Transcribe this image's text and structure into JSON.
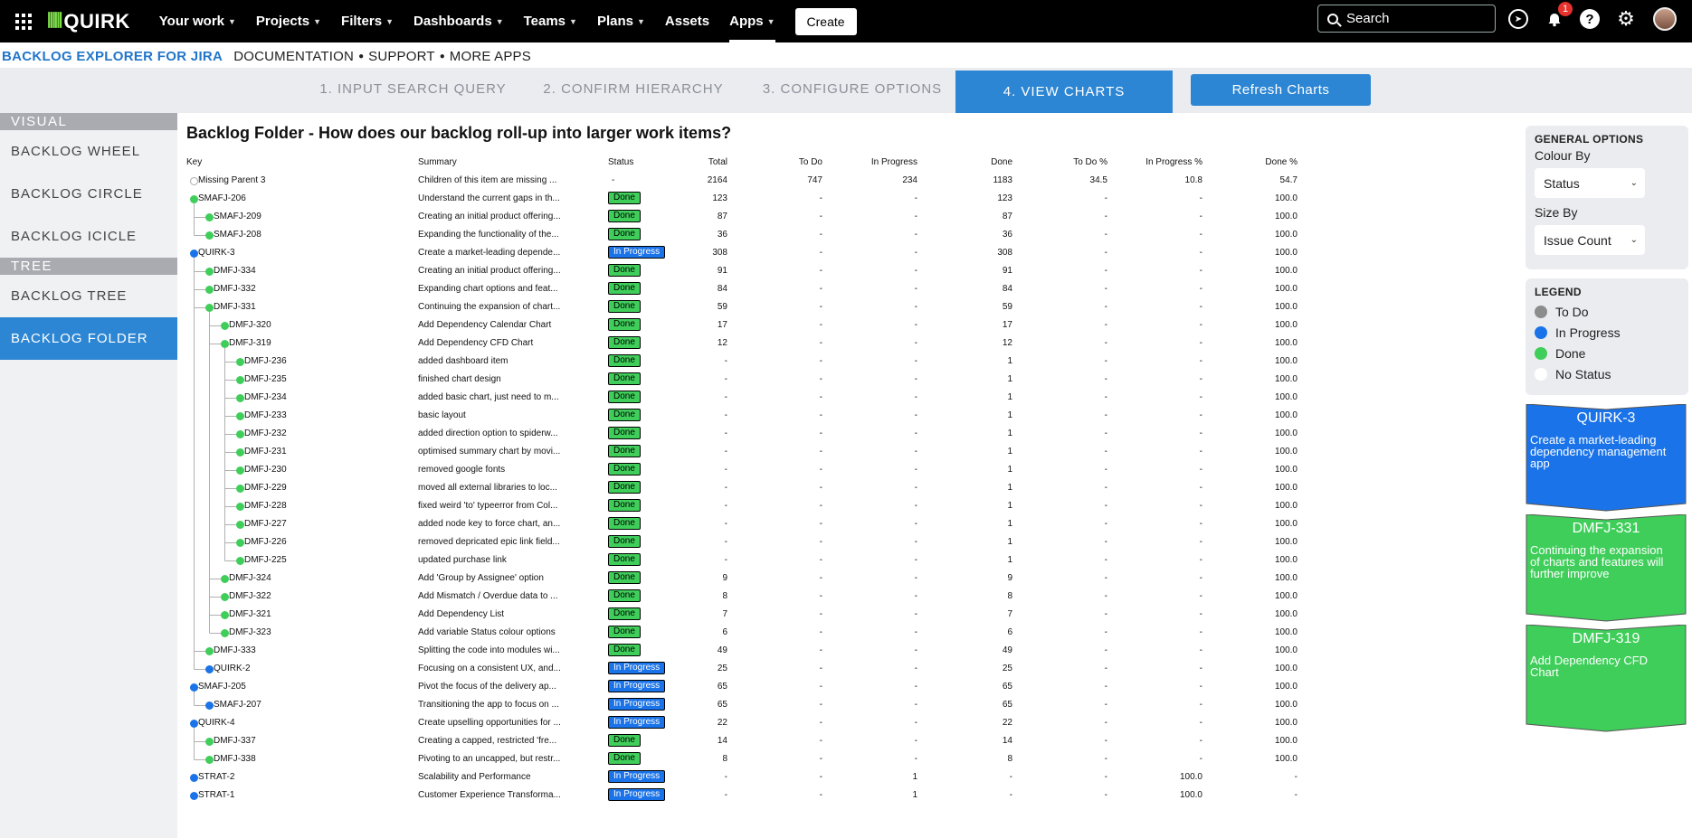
{
  "topnav": {
    "logo_mark": "⦀⦀",
    "logo_text": "QUIRK",
    "items": [
      {
        "label": "Your work",
        "chevron": true
      },
      {
        "label": "Projects",
        "chevron": true
      },
      {
        "label": "Filters",
        "chevron": true
      },
      {
        "label": "Dashboards",
        "chevron": true
      },
      {
        "label": "Teams",
        "chevron": true
      },
      {
        "label": "Plans",
        "chevron": true
      },
      {
        "label": "Assets",
        "chevron": false
      },
      {
        "label": "Apps",
        "chevron": true,
        "active": true
      }
    ],
    "create_label": "Create",
    "search_placeholder": "Search",
    "notification_count": "1"
  },
  "apphead": {
    "app_name": "BACKLOG EXPLORER FOR JIRA",
    "links": [
      "DOCUMENTATION",
      "SUPPORT",
      "MORE APPS"
    ]
  },
  "steps": [
    {
      "label": "1. INPUT SEARCH QUERY"
    },
    {
      "label": "2. CONFIRM HIERARCHY"
    },
    {
      "label": "3. CONFIGURE OPTIONS"
    },
    {
      "label": "4. VIEW CHARTS",
      "active": true
    }
  ],
  "refresh_label": "Refresh Charts",
  "sidebar": {
    "visual_header": "VISUAL",
    "visual_items": [
      "BACKLOG WHEEL",
      "BACKLOG CIRCLE",
      "BACKLOG ICICLE"
    ],
    "tree_header": "TREE",
    "tree_items": [
      {
        "label": "BACKLOG TREE"
      },
      {
        "label": "BACKLOG FOLDER",
        "active": true
      }
    ]
  },
  "main": {
    "title": "Backlog Folder - How does our backlog roll-up into larger work items?",
    "columns": {
      "key": "Key",
      "summary": "Summary",
      "status": "Status",
      "total": "Total",
      "todo": "To Do",
      "inprog": "In Progress",
      "done": "Done",
      "todop": "To Do %",
      "inprogp": "In Progress %",
      "donep": "Done %"
    },
    "rows": [
      {
        "depth": 0,
        "key": "Missing Parent 3",
        "summary": "Children of this item are missing ...",
        "status": "",
        "dot": "none",
        "total": "2164",
        "todo": "747",
        "inprog": "234",
        "done": "1183",
        "todop": "34.5",
        "inprogp": "10.8",
        "donep": "54.7",
        "status_dash": "-"
      },
      {
        "depth": 0,
        "key": "SMAFJ-206",
        "summary": "Understand the current gaps in th...",
        "status": "Done",
        "dot": "done",
        "total": "123",
        "todo": "-",
        "inprog": "-",
        "done": "123",
        "todop": "-",
        "inprogp": "-",
        "donep": "100.0"
      },
      {
        "depth": 1,
        "key": "SMAFJ-209",
        "summary": "Creating an initial product offering...",
        "status": "Done",
        "dot": "done",
        "total": "87",
        "todo": "-",
        "inprog": "-",
        "done": "87",
        "todop": "-",
        "inprogp": "-",
        "donep": "100.0"
      },
      {
        "depth": 1,
        "key": "SMAFJ-208",
        "summary": "Expanding the functionality of the...",
        "status": "Done",
        "dot": "done",
        "total": "36",
        "todo": "-",
        "inprog": "-",
        "done": "36",
        "todop": "-",
        "inprogp": "-",
        "donep": "100.0"
      },
      {
        "depth": 0,
        "key": "QUIRK-3",
        "summary": "Create a market-leading depende...",
        "status": "In Progress",
        "dot": "inprog",
        "total": "308",
        "todo": "-",
        "inprog": "-",
        "done": "308",
        "todop": "-",
        "inprogp": "-",
        "donep": "100.0"
      },
      {
        "depth": 1,
        "key": "DMFJ-334",
        "summary": "Creating an initial product offering...",
        "status": "Done",
        "dot": "done",
        "total": "91",
        "todo": "-",
        "inprog": "-",
        "done": "91",
        "todop": "-",
        "inprogp": "-",
        "donep": "100.0"
      },
      {
        "depth": 1,
        "key": "DMFJ-332",
        "summary": "Expanding chart options and feat...",
        "status": "Done",
        "dot": "done",
        "total": "84",
        "todo": "-",
        "inprog": "-",
        "done": "84",
        "todop": "-",
        "inprogp": "-",
        "donep": "100.0"
      },
      {
        "depth": 1,
        "key": "DMFJ-331",
        "summary": "Continuing the expansion of chart...",
        "status": "Done",
        "dot": "done",
        "total": "59",
        "todo": "-",
        "inprog": "-",
        "done": "59",
        "todop": "-",
        "inprogp": "-",
        "donep": "100.0"
      },
      {
        "depth": 2,
        "key": "DMFJ-320",
        "summary": "Add Dependency Calendar Chart",
        "status": "Done",
        "dot": "done",
        "total": "17",
        "todo": "-",
        "inprog": "-",
        "done": "17",
        "todop": "-",
        "inprogp": "-",
        "donep": "100.0"
      },
      {
        "depth": 2,
        "key": "DMFJ-319",
        "summary": "Add Dependency CFD Chart",
        "status": "Done",
        "dot": "done",
        "total": "12",
        "todo": "-",
        "inprog": "-",
        "done": "12",
        "todop": "-",
        "inprogp": "-",
        "donep": "100.0"
      },
      {
        "depth": 3,
        "key": "DMFJ-236",
        "summary": "added dashboard item",
        "status": "Done",
        "dot": "done",
        "total": "-",
        "todo": "-",
        "inprog": "-",
        "done": "1",
        "todop": "-",
        "inprogp": "-",
        "donep": "100.0"
      },
      {
        "depth": 3,
        "key": "DMFJ-235",
        "summary": "finished chart design",
        "status": "Done",
        "dot": "done",
        "total": "-",
        "todo": "-",
        "inprog": "-",
        "done": "1",
        "todop": "-",
        "inprogp": "-",
        "donep": "100.0"
      },
      {
        "depth": 3,
        "key": "DMFJ-234",
        "summary": "added basic chart, just need to m...",
        "status": "Done",
        "dot": "done",
        "total": "-",
        "todo": "-",
        "inprog": "-",
        "done": "1",
        "todop": "-",
        "inprogp": "-",
        "donep": "100.0"
      },
      {
        "depth": 3,
        "key": "DMFJ-233",
        "summary": "basic layout",
        "status": "Done",
        "dot": "done",
        "total": "-",
        "todo": "-",
        "inprog": "-",
        "done": "1",
        "todop": "-",
        "inprogp": "-",
        "donep": "100.0"
      },
      {
        "depth": 3,
        "key": "DMFJ-232",
        "summary": "added direction option to spiderw...",
        "status": "Done",
        "dot": "done",
        "total": "-",
        "todo": "-",
        "inprog": "-",
        "done": "1",
        "todop": "-",
        "inprogp": "-",
        "donep": "100.0"
      },
      {
        "depth": 3,
        "key": "DMFJ-231",
        "summary": "optimised summary chart by movi...",
        "status": "Done",
        "dot": "done",
        "total": "-",
        "todo": "-",
        "inprog": "-",
        "done": "1",
        "todop": "-",
        "inprogp": "-",
        "donep": "100.0"
      },
      {
        "depth": 3,
        "key": "DMFJ-230",
        "summary": "removed google fonts",
        "status": "Done",
        "dot": "done",
        "total": "-",
        "todo": "-",
        "inprog": "-",
        "done": "1",
        "todop": "-",
        "inprogp": "-",
        "donep": "100.0"
      },
      {
        "depth": 3,
        "key": "DMFJ-229",
        "summary": "moved all external libraries to loc...",
        "status": "Done",
        "dot": "done",
        "total": "-",
        "todo": "-",
        "inprog": "-",
        "done": "1",
        "todop": "-",
        "inprogp": "-",
        "donep": "100.0"
      },
      {
        "depth": 3,
        "key": "DMFJ-228",
        "summary": "fixed weird 'to' typeerror from Col...",
        "status": "Done",
        "dot": "done",
        "total": "-",
        "todo": "-",
        "inprog": "-",
        "done": "1",
        "todop": "-",
        "inprogp": "-",
        "donep": "100.0"
      },
      {
        "depth": 3,
        "key": "DMFJ-227",
        "summary": "added node key to force chart, an...",
        "status": "Done",
        "dot": "done",
        "total": "-",
        "todo": "-",
        "inprog": "-",
        "done": "1",
        "todop": "-",
        "inprogp": "-",
        "donep": "100.0"
      },
      {
        "depth": 3,
        "key": "DMFJ-226",
        "summary": "removed depricated epic link field...",
        "status": "Done",
        "dot": "done",
        "total": "-",
        "todo": "-",
        "inprog": "-",
        "done": "1",
        "todop": "-",
        "inprogp": "-",
        "donep": "100.0"
      },
      {
        "depth": 3,
        "key": "DMFJ-225",
        "summary": "updated purchase link",
        "status": "Done",
        "dot": "done",
        "total": "-",
        "todo": "-",
        "inprog": "-",
        "done": "1",
        "todop": "-",
        "inprogp": "-",
        "donep": "100.0"
      },
      {
        "depth": 2,
        "key": "DMFJ-324",
        "summary": "Add 'Group by Assignee' option",
        "status": "Done",
        "dot": "done",
        "total": "9",
        "todo": "-",
        "inprog": "-",
        "done": "9",
        "todop": "-",
        "inprogp": "-",
        "donep": "100.0"
      },
      {
        "depth": 2,
        "key": "DMFJ-322",
        "summary": "Add Mismatch / Overdue data to ...",
        "status": "Done",
        "dot": "done",
        "total": "8",
        "todo": "-",
        "inprog": "-",
        "done": "8",
        "todop": "-",
        "inprogp": "-",
        "donep": "100.0"
      },
      {
        "depth": 2,
        "key": "DMFJ-321",
        "summary": "Add Dependency List",
        "status": "Done",
        "dot": "done",
        "total": "7",
        "todo": "-",
        "inprog": "-",
        "done": "7",
        "todop": "-",
        "inprogp": "-",
        "donep": "100.0"
      },
      {
        "depth": 2,
        "key": "DMFJ-323",
        "summary": "Add variable Status colour options",
        "status": "Done",
        "dot": "done",
        "total": "6",
        "todo": "-",
        "inprog": "-",
        "done": "6",
        "todop": "-",
        "inprogp": "-",
        "donep": "100.0"
      },
      {
        "depth": 1,
        "key": "DMFJ-333",
        "summary": "Splitting the code into modules wi...",
        "status": "Done",
        "dot": "done",
        "total": "49",
        "todo": "-",
        "inprog": "-",
        "done": "49",
        "todop": "-",
        "inprogp": "-",
        "donep": "100.0"
      },
      {
        "depth": 1,
        "key": "QUIRK-2",
        "summary": "Focusing on a consistent UX, and...",
        "status": "In Progress",
        "dot": "inprog",
        "total": "25",
        "todo": "-",
        "inprog": "-",
        "done": "25",
        "todop": "-",
        "inprogp": "-",
        "donep": "100.0"
      },
      {
        "depth": 0,
        "key": "SMAFJ-205",
        "summary": "Pivot the focus of the delivery ap...",
        "status": "In Progress",
        "dot": "inprog",
        "total": "65",
        "todo": "-",
        "inprog": "-",
        "done": "65",
        "todop": "-",
        "inprogp": "-",
        "donep": "100.0"
      },
      {
        "depth": 1,
        "key": "SMAFJ-207",
        "summary": "Transitioning the app to focus on ...",
        "status": "In Progress",
        "dot": "inprog",
        "total": "65",
        "todo": "-",
        "inprog": "-",
        "done": "65",
        "todop": "-",
        "inprogp": "-",
        "donep": "100.0"
      },
      {
        "depth": 0,
        "key": "QUIRK-4",
        "summary": "Create upselling opportunities for ...",
        "status": "In Progress",
        "dot": "inprog",
        "total": "22",
        "todo": "-",
        "inprog": "-",
        "done": "22",
        "todop": "-",
        "inprogp": "-",
        "donep": "100.0"
      },
      {
        "depth": 1,
        "key": "DMFJ-337",
        "summary": "Creating a capped, restricted 'fre...",
        "status": "Done",
        "dot": "done",
        "total": "14",
        "todo": "-",
        "inprog": "-",
        "done": "14",
        "todop": "-",
        "inprogp": "-",
        "donep": "100.0"
      },
      {
        "depth": 1,
        "key": "DMFJ-338",
        "summary": "Pivoting to an uncapped, but restr...",
        "status": "Done",
        "dot": "done",
        "total": "8",
        "todo": "-",
        "inprog": "-",
        "done": "8",
        "todop": "-",
        "inprogp": "-",
        "donep": "100.0"
      },
      {
        "depth": 0,
        "key": "STRAT-2",
        "summary": "Scalability and Performance",
        "status": "In Progress",
        "dot": "inprog",
        "total": "-",
        "todo": "-",
        "inprog": "1",
        "done": "-",
        "todop": "-",
        "inprogp": "100.0",
        "donep": "-"
      },
      {
        "depth": 0,
        "key": "STRAT-1",
        "summary": "Customer Experience Transforma...",
        "status": "In Progress",
        "dot": "inprog",
        "total": "-",
        "todo": "-",
        "inprog": "1",
        "done": "-",
        "todop": "-",
        "inprogp": "100.0",
        "donep": "-"
      }
    ]
  },
  "options": {
    "title": "GENERAL OPTIONS",
    "colour_label": "Colour By",
    "colour_value": "Status",
    "size_label": "Size By",
    "size_value": "Issue Count"
  },
  "legend": {
    "title": "LEGEND",
    "items": [
      {
        "label": "To Do",
        "color": "#8c8c8c"
      },
      {
        "label": "In Progress",
        "color": "#1a73e8"
      },
      {
        "label": "Done",
        "color": "#3fce5a"
      },
      {
        "label": "No Status",
        "color": "#ffffff"
      }
    ]
  },
  "cards": [
    {
      "key": "QUIRK-3",
      "summary": "Create a market-leading dependency management app",
      "color": "#1a73e8"
    },
    {
      "key": "DMFJ-331",
      "summary": "Continuing the expansion of charts and features will further improve",
      "color": "#3fce5a"
    },
    {
      "key": "DMFJ-319",
      "summary": "Add Dependency CFD Chart",
      "color": "#3fce5a"
    }
  ],
  "colors": {
    "done": "#3fce5a",
    "inprog": "#1a73e8",
    "accent": "#2d86d3"
  }
}
